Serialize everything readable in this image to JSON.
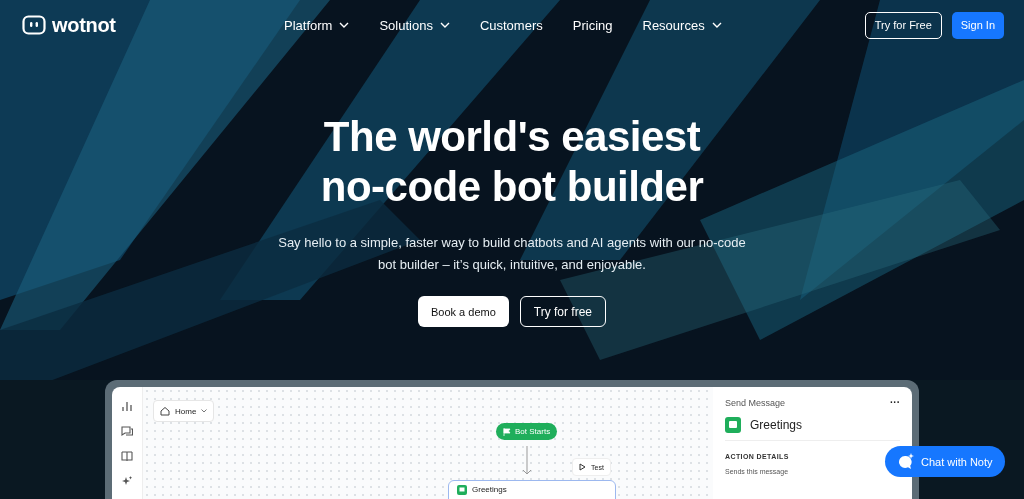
{
  "brand": {
    "name": "wotnot"
  },
  "nav": [
    {
      "label": "Platform",
      "dropdown": true
    },
    {
      "label": "Solutions",
      "dropdown": true
    },
    {
      "label": "Customers",
      "dropdown": false
    },
    {
      "label": "Pricing",
      "dropdown": false
    },
    {
      "label": "Resources",
      "dropdown": true
    }
  ],
  "header_buttons": [
    {
      "label": "Try for Free",
      "kind": "outline"
    },
    {
      "label": "Sign In",
      "kind": "primary"
    }
  ],
  "hero": {
    "title_lines": [
      "The world's easiest",
      "no-code bot builder"
    ],
    "subtitle": "Say hello to a simple, faster way to build chatbots and AI agents with our no-code bot builder – it’s quick, intuitive, and enjoyable.",
    "buttons": [
      {
        "label": "Book a demo",
        "kind": "solid"
      },
      {
        "label": "Try for free",
        "kind": "outline"
      }
    ]
  },
  "builder": {
    "breadcrumb": "Home",
    "start_node": "Bot Starts",
    "test_button": "Test",
    "node": "Greetings",
    "panel": {
      "heading": "Send Message",
      "more": "···",
      "title": "Greetings",
      "section": "ACTION DETAILS",
      "description": "Sends this message"
    }
  },
  "chat_widget": {
    "label": "Chat with Noty"
  }
}
